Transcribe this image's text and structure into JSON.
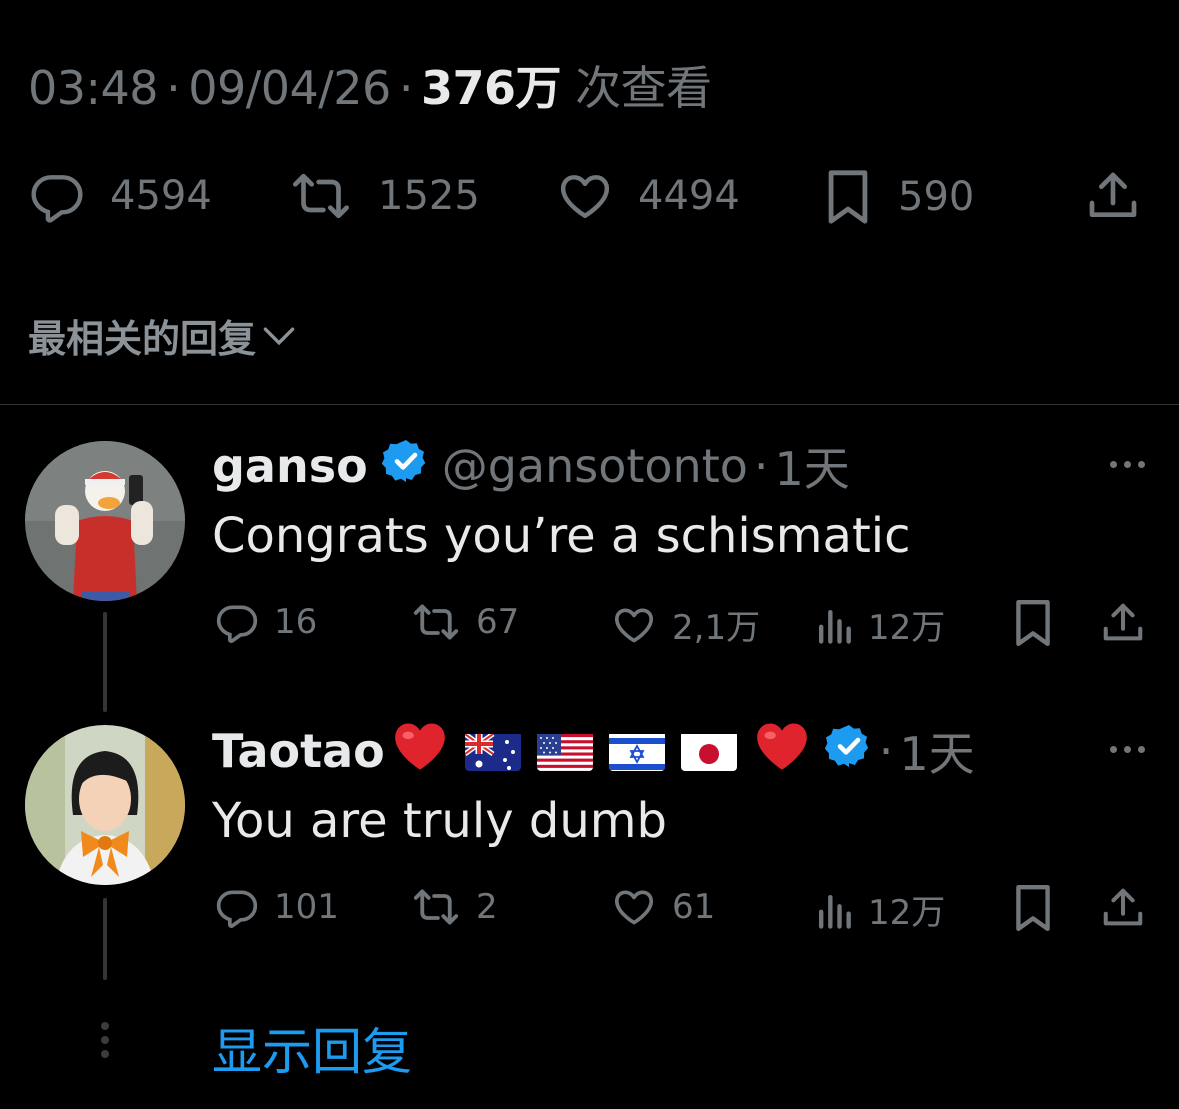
{
  "tweet": {
    "time": "03:48",
    "date": "09/04/26",
    "views_count": "376万",
    "views_label": "次查看",
    "separator": "·",
    "actions": {
      "replies": "4594",
      "reposts": "1525",
      "likes": "4494",
      "bookmarks": "590"
    }
  },
  "sort_label": "最相关的回复",
  "replies": [
    {
      "name": "ganso",
      "handle": "@gansotonto",
      "time": "1天",
      "text": "Congrats you’re a schismatic",
      "verified": true,
      "stats": {
        "replies": "16",
        "reposts": "67",
        "likes": "2,1万",
        "views": "12万"
      }
    },
    {
      "name": "Taotao",
      "name_emojis": [
        "heart",
        "flag-australia",
        "flag-usa",
        "flag-israel",
        "flag-japan",
        "heart"
      ],
      "time": "1天",
      "text": "You are truly dumb",
      "verified": true,
      "stats": {
        "replies": "101",
        "reposts": "2",
        "likes": "61",
        "views": "12万"
      }
    }
  ],
  "show_replies": "显示回复",
  "colors": {
    "background": "#000000",
    "text_primary": "#e7e9ea",
    "text_secondary": "#71767b",
    "accent_blue": "#1d9bf0",
    "heart_red": "#e0242e"
  }
}
